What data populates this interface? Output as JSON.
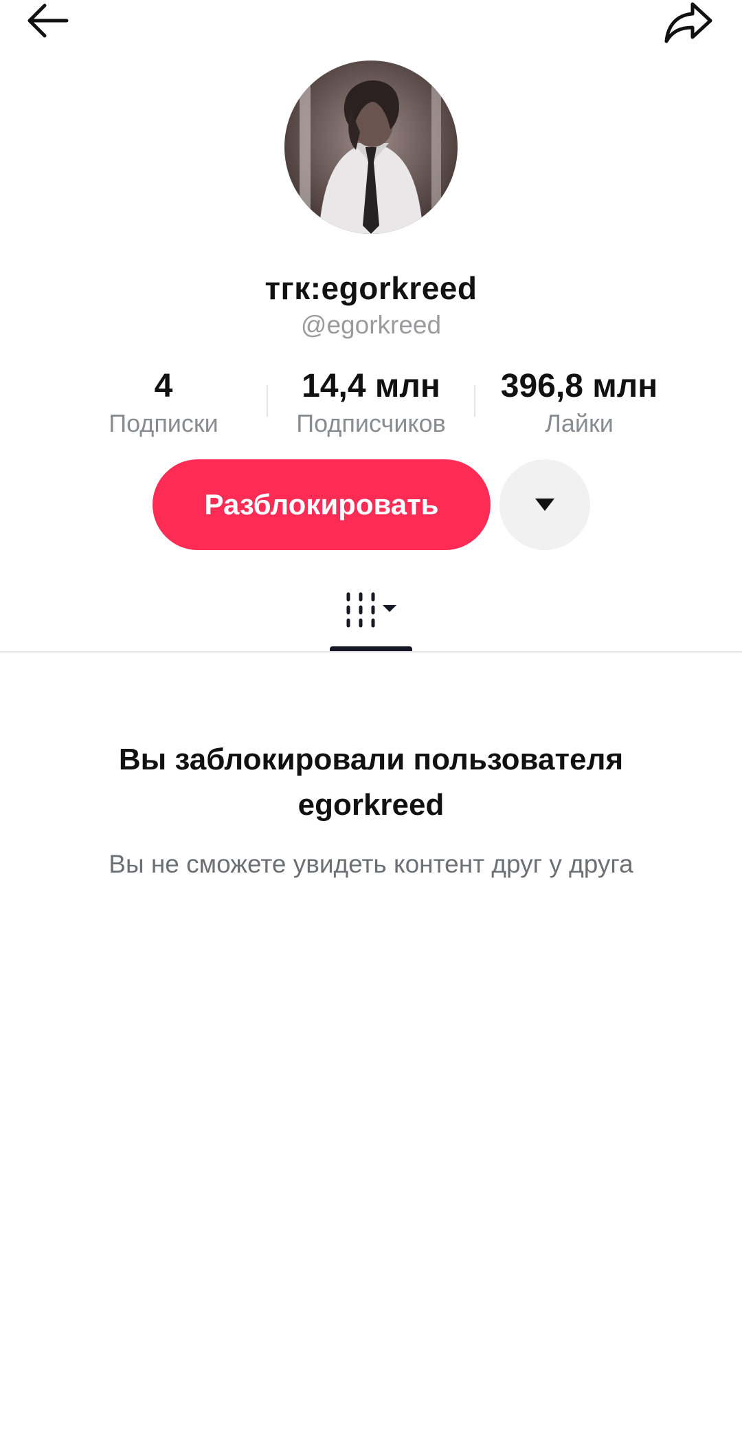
{
  "header": {
    "back_icon": "arrow-left-icon",
    "share_icon": "share-arrow-icon"
  },
  "profile": {
    "display_name": "тгк:egorkreed",
    "username": "@egorkreed"
  },
  "stats": [
    {
      "value": "4",
      "label": "Подписки"
    },
    {
      "value": "14,4 млн",
      "label": "Подписчиков"
    },
    {
      "value": "396,8 млн",
      "label": "Лайки"
    }
  ],
  "actions": {
    "unblock_label": "Разблокировать",
    "more_icon": "caret-down-icon",
    "accent_color": "#fe2c55"
  },
  "tabs": {
    "videos_icon": "video-grid-icon",
    "dropdown_icon": "caret-down-icon"
  },
  "blocked": {
    "title": "Вы заблокировали пользователя egorkreed",
    "subtitle": "Вы не сможете увидеть контент друг у друга"
  }
}
